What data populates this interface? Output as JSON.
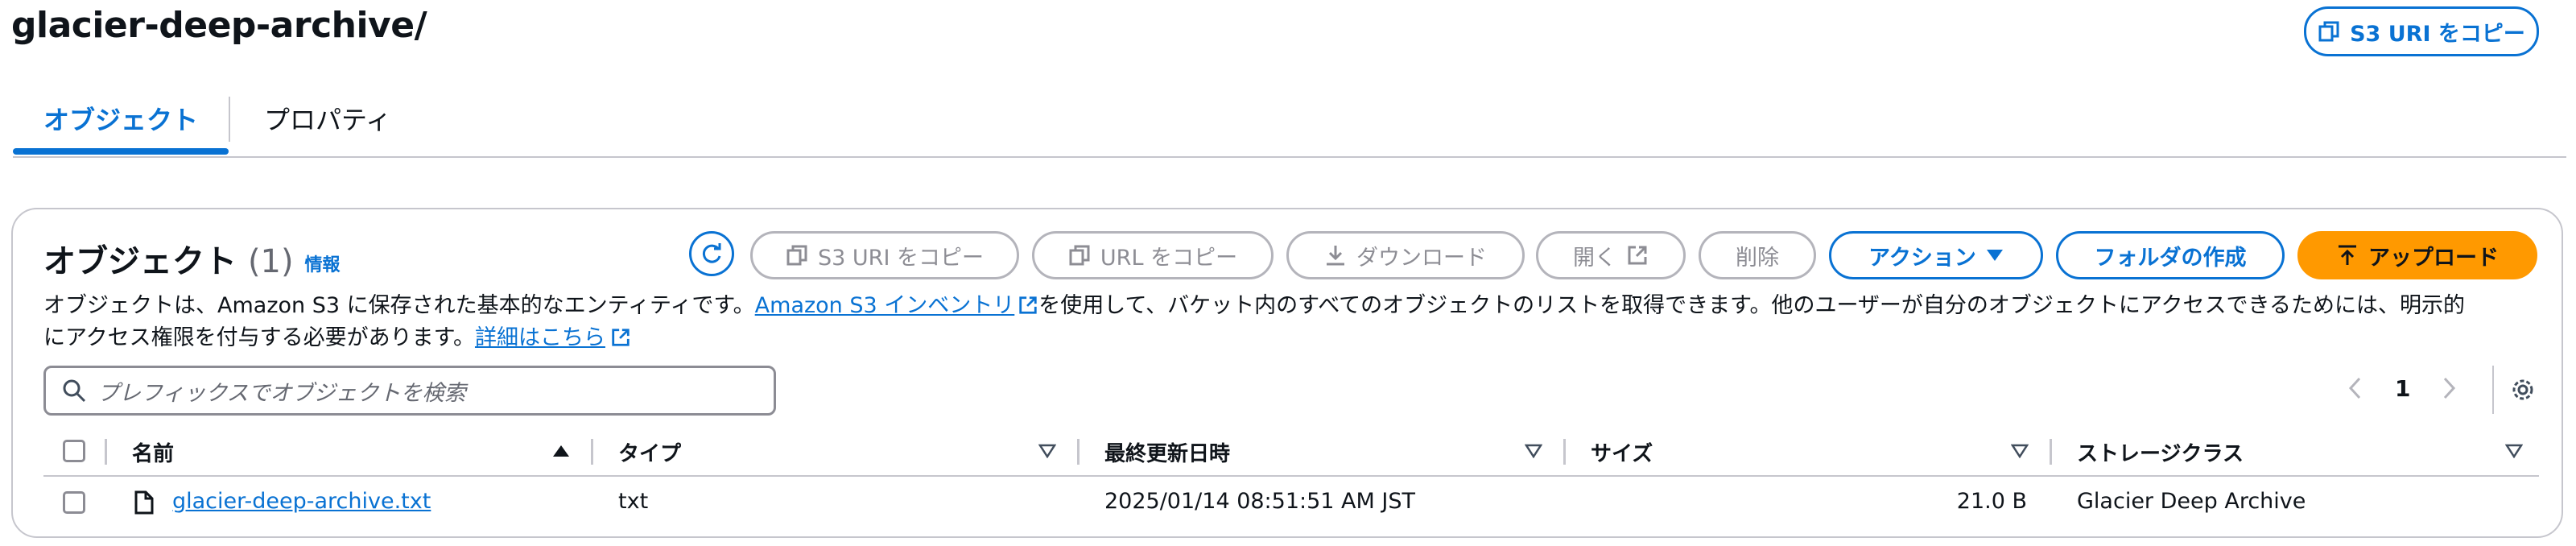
{
  "page": {
    "title": "glacier-deep-archive/"
  },
  "header": {
    "copy_uri_label": "S3 URI をコピー"
  },
  "tabs": [
    {
      "label": "オブジェクト",
      "active": true
    },
    {
      "label": "プロパティ",
      "active": false
    }
  ],
  "panel": {
    "title": "オブジェクト",
    "count": "(1)",
    "info_label": "情報",
    "description_1": "オブジェクトは、Amazon S3 に保存された基本的なエンティティです。",
    "inventory_link": "Amazon S3 インベントリ",
    "description_2": "を使用して、バケット内のすべてのオブジェクトのリストを取得できます。他のユーザーが自分のオブジェクトにアクセスできるためには、明示的",
    "description_3": "にアクセス権限を付与する必要があります。",
    "details_link": "詳細はこちら"
  },
  "toolbar": {
    "copy_uri": "S3 URI をコピー",
    "copy_url": "URL をコピー",
    "download": "ダウンロード",
    "open": "開く",
    "delete": "削除",
    "actions": "アクション",
    "create_folder": "フォルダの作成",
    "upload": "アップロード"
  },
  "search": {
    "placeholder": "プレフィックスでオブジェクトを検索"
  },
  "pagination": {
    "page": "1"
  },
  "table": {
    "columns": [
      "名前",
      "タイプ",
      "最終更新日時",
      "サイズ",
      "ストレージクラス"
    ],
    "rows": [
      {
        "name": "glacier-deep-archive.txt",
        "type": "txt",
        "modified": "2025/01/14 08:51:51 AM JST",
        "size": "21.0 B",
        "storage_class": "Glacier Deep Archive"
      }
    ]
  },
  "colors": {
    "accent": "#0972d3",
    "upload": "#ff9900",
    "disabled": "#8d8d94",
    "border": "#c6c6cd"
  },
  "icons": [
    "copy-icon",
    "refresh-icon",
    "download-icon",
    "external-link-icon",
    "caret-down-icon",
    "upload-arrow-icon",
    "search-icon",
    "chevron-left-icon",
    "chevron-right-icon",
    "settings-gear-icon",
    "sort-ascending-icon",
    "sort-descending-icon",
    "file-icon"
  ]
}
